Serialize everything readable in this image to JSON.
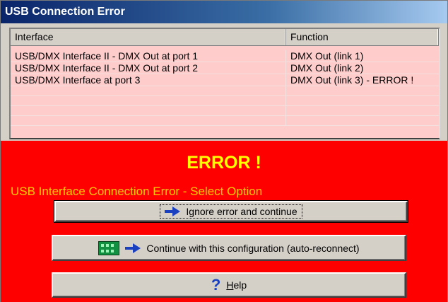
{
  "window": {
    "title": "USB Connection Error"
  },
  "list": {
    "headers": [
      "Interface",
      "Function"
    ],
    "rows": [
      {
        "interface": "USB/DMX Interface II - DMX Out at port 1",
        "function": "DMX Out (link 1)"
      },
      {
        "interface": "USB/DMX Interface II - DMX Out at port 2",
        "function": "DMX Out (link 2)"
      },
      {
        "interface": "USB/DMX Interface at port 3",
        "function": "DMX Out (link 3) - ERROR !"
      }
    ]
  },
  "error": {
    "title": "ERROR !",
    "subtitle": "USB Interface Connection Error - Select Option"
  },
  "buttons": {
    "ignore": {
      "label": "Ignore error and continue",
      "icon": "arrow-right-icon"
    },
    "continue": {
      "label": "Continue with this configuration (auto-reconnect)",
      "icon": "usb-interface-icon"
    },
    "help": {
      "label_prefix": "",
      "label_hotkey": "H",
      "label_rest": "elp",
      "icon": "question-icon"
    }
  },
  "colors": {
    "title_bar": "#0a246a",
    "list_bg": "#ffcccc",
    "error_bg": "#ff0000",
    "error_title": "#ffff00",
    "error_sub": "#ffcc00",
    "arrow": "#1a3fbf"
  }
}
